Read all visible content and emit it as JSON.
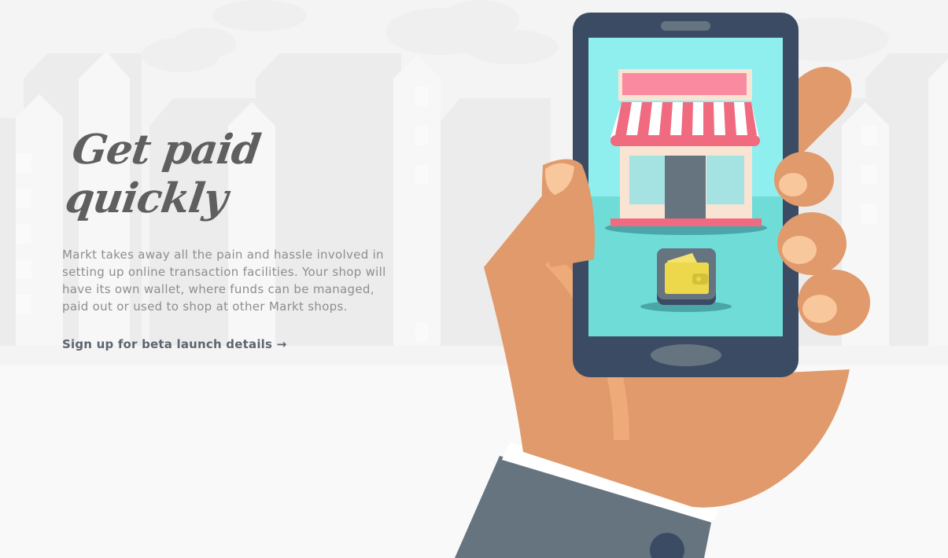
{
  "hero": {
    "headline": "Get paid quickly",
    "description": "Markt takes away all the pain and hassle involved in setting up online transaction facilities. Your shop will have its own wallet, where funds can be managed, paid out or used to shop at other Markt shops.",
    "cta_label": "Sign up for beta launch details",
    "cta_arrow": "→"
  },
  "colors": {
    "background": "#f9f9f9",
    "headline": "#5f5f5f",
    "body_text": "#8e8e8e",
    "cta": "#5d6570",
    "phone_body": "#3b4b63",
    "phone_screen": "#8feeee",
    "awning_red": "#f06a80",
    "wallet_yellow": "#ecd84a",
    "skin": "#e09a6b",
    "sleeve": "#667480"
  },
  "icons": [
    "shop-icon",
    "wallet-icon"
  ]
}
